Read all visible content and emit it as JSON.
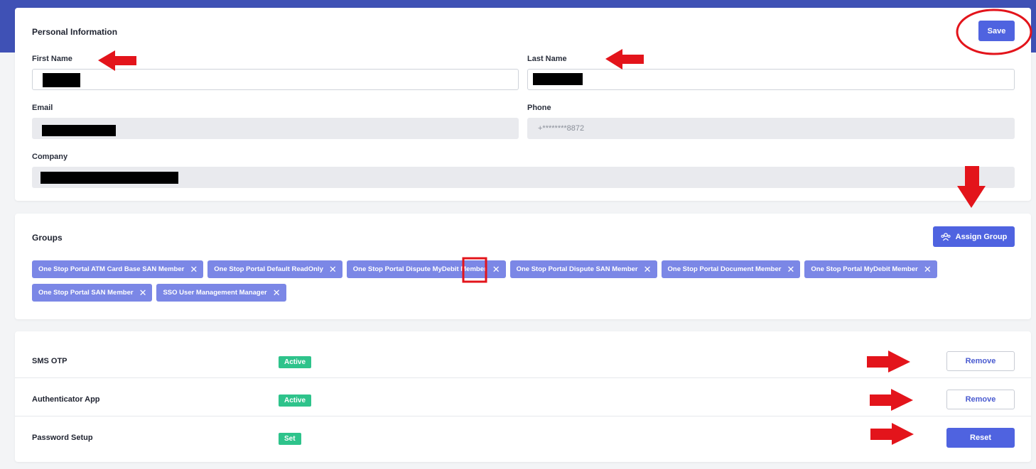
{
  "personal": {
    "title": "Personal Information",
    "save_label": "Save",
    "first_name_label": "First Name",
    "last_name_label": "Last Name",
    "email_label": "Email",
    "phone_label": "Phone",
    "phone_value": "+********8872",
    "company_label": "Company"
  },
  "groups": {
    "title": "Groups",
    "assign_label": "Assign Group",
    "items": [
      "One Stop Portal ATM Card Base SAN Member",
      "One Stop Portal Default ReadOnly",
      "One Stop Portal Dispute MyDebit Member",
      "One Stop Portal Dispute SAN Member",
      "One Stop Portal Document Member",
      "One Stop Portal MyDebit Member",
      "One Stop Portal SAN Member",
      "SSO User Management Manager"
    ]
  },
  "auth": {
    "rows": [
      {
        "label": "SMS OTP",
        "status": "Active",
        "action": "Remove"
      },
      {
        "label": "Authenticator App",
        "status": "Active",
        "action": "Remove"
      },
      {
        "label": "Password Setup",
        "status": "Set",
        "action": "Reset"
      }
    ]
  },
  "colors": {
    "header_band": "#3f51b5",
    "primary": "#4f63e0",
    "chip": "#7b87e6",
    "badge_active": "#2ec38b",
    "annotation_red": "#e3141b"
  },
  "icons": {
    "assign_group_icon": "users-group-icon",
    "chip_remove_icon": "close-icon"
  }
}
